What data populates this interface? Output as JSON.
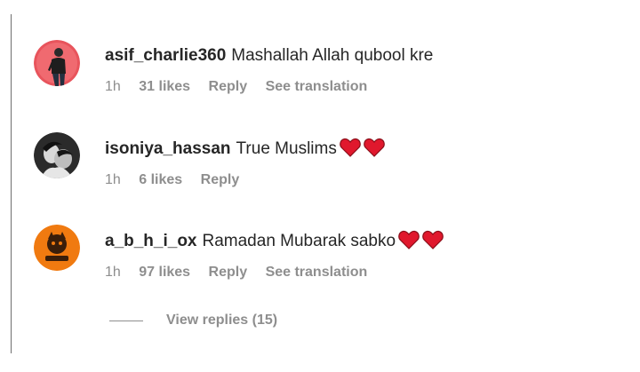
{
  "colors": {
    "text_primary": "#262626",
    "text_secondary": "#8e8e8e",
    "heart_red": "#e0182d"
  },
  "comments": [
    {
      "username": "asif_charlie360",
      "text": "Mashallah Allah qubool kre",
      "time": "1h",
      "likes": "31 likes",
      "reply": "Reply",
      "translation": "See translation",
      "avatar_icon": "avatar-man-red-background-icon"
    },
    {
      "username": "isoniya_hassan",
      "text": "True Muslims",
      "hearts": 2,
      "time": "1h",
      "likes": "6 likes",
      "reply": "Reply",
      "avatar_icon": "avatar-couple-photo-icon"
    },
    {
      "username": "a_b_h_i_ox",
      "text": "Ramadan Mubarak sabko",
      "hearts": 2,
      "time": "1h",
      "likes": "97 likes",
      "reply": "Reply",
      "translation": "See translation",
      "avatar_icon": "avatar-orange-logo-icon"
    }
  ],
  "view_replies": {
    "label": "View replies (15)"
  }
}
